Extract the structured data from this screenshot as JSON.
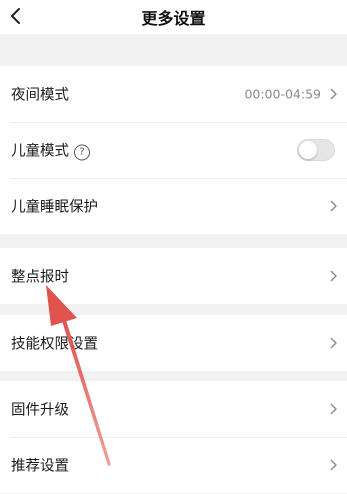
{
  "header": {
    "title": "更多设置",
    "back_icon": "chevron-left-icon"
  },
  "groups": [
    {
      "items": [
        {
          "label": "夜间模式",
          "value": "00:00-04:59",
          "icon": "chevron-right-icon"
        },
        {
          "label": "儿童模式",
          "help_icon": "question-circle-icon",
          "help_glyph": "?",
          "toggle": {
            "on": false
          }
        },
        {
          "label": "儿童睡眠保护",
          "icon": "chevron-right-icon"
        }
      ]
    },
    {
      "items": [
        {
          "label": "整点报时",
          "icon": "chevron-right-icon"
        }
      ]
    },
    {
      "items": [
        {
          "label": "技能权限设置",
          "icon": "chevron-right-icon"
        }
      ]
    },
    {
      "items": [
        {
          "label": "固件升级",
          "icon": "chevron-right-icon"
        },
        {
          "label": "推荐设置",
          "icon": "chevron-right-icon"
        }
      ]
    }
  ],
  "annotation": {
    "type": "arrow",
    "color": "#e0534f",
    "icon": "arrow-annotation"
  },
  "colors": {
    "background": "#f2f2f2",
    "panel": "#ffffff",
    "text": "#1a1a1a",
    "secondary_text": "#8a8a8a"
  }
}
